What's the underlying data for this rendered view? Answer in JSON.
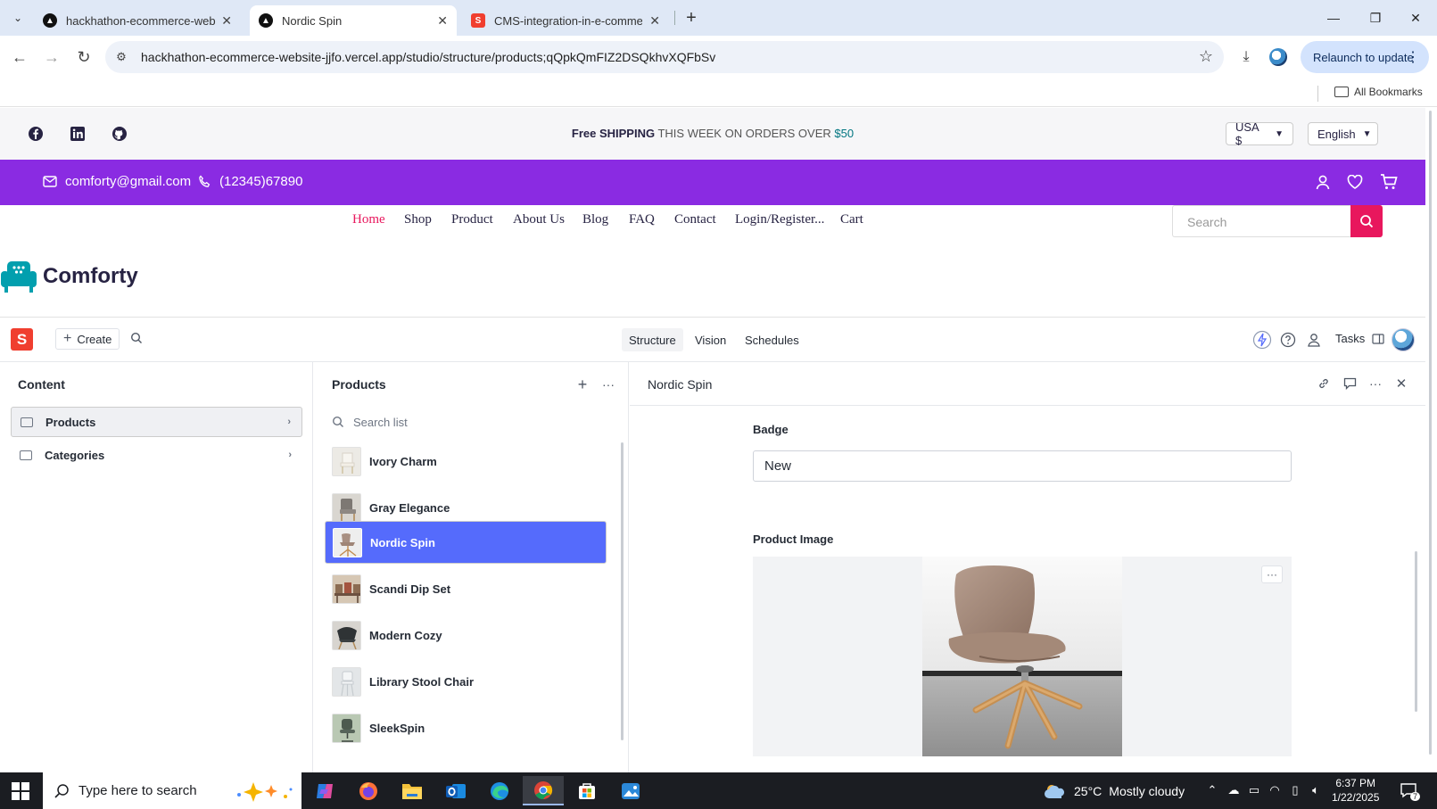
{
  "browser": {
    "tabs": [
      {
        "title": "hackhathon-ecommerce-website",
        "active": false
      },
      {
        "title": "Nordic Spin",
        "active": true
      },
      {
        "title": "CMS-integration-in-e-commerce",
        "active": false
      }
    ],
    "url": "hackhathon-ecommerce-website-jjfo.vercel.app/studio/structure/products;qQpkQmFIZ2DSQkhvXQFbSv",
    "relaunch_label": "Relaunch to update",
    "bookmarks_label": "All Bookmarks"
  },
  "site": {
    "promo": {
      "bold": "Free SHIPPING",
      "middle": " THIS WEEK ON ORDERS OVER ",
      "price": "$50"
    },
    "currency": "USA $",
    "language": "English",
    "email": "comforty@gmail.com",
    "phone": "(12345)67890",
    "nav": [
      "Home",
      "Shop",
      "Product",
      "About Us",
      "Blog",
      "FAQ",
      "Contact",
      "Login/Register...",
      "Cart"
    ],
    "search_placeholder": "Search",
    "brand": "Comforty",
    "accent": "#8a2be2",
    "pink": "#e8175d"
  },
  "studio": {
    "create_label": "Create",
    "tabs": [
      "Structure",
      "Vision",
      "Schedules"
    ],
    "active_tab": "Structure",
    "tasks_label": "Tasks",
    "content_pane": {
      "title": "Content",
      "items": [
        "Products",
        "Categories"
      ]
    },
    "products_pane": {
      "title": "Products",
      "search_placeholder": "Search list",
      "items": [
        "Ivory Charm",
        "Gray Elegance",
        "Nordic Spin",
        "Scandi Dip Set",
        "Modern Cozy",
        "Library Stool Chair",
        "SleekSpin"
      ],
      "selected": "Nordic Spin"
    },
    "document": {
      "title": "Nordic Spin",
      "badge_label": "Badge",
      "badge_value": "New",
      "image_label": "Product Image"
    }
  },
  "taskbar": {
    "search_placeholder": "Type here to search",
    "weather_temp": "25°C",
    "weather_text": "Mostly cloudy",
    "time": "6:37 PM",
    "date": "1/22/2025",
    "notification_count": "7"
  }
}
